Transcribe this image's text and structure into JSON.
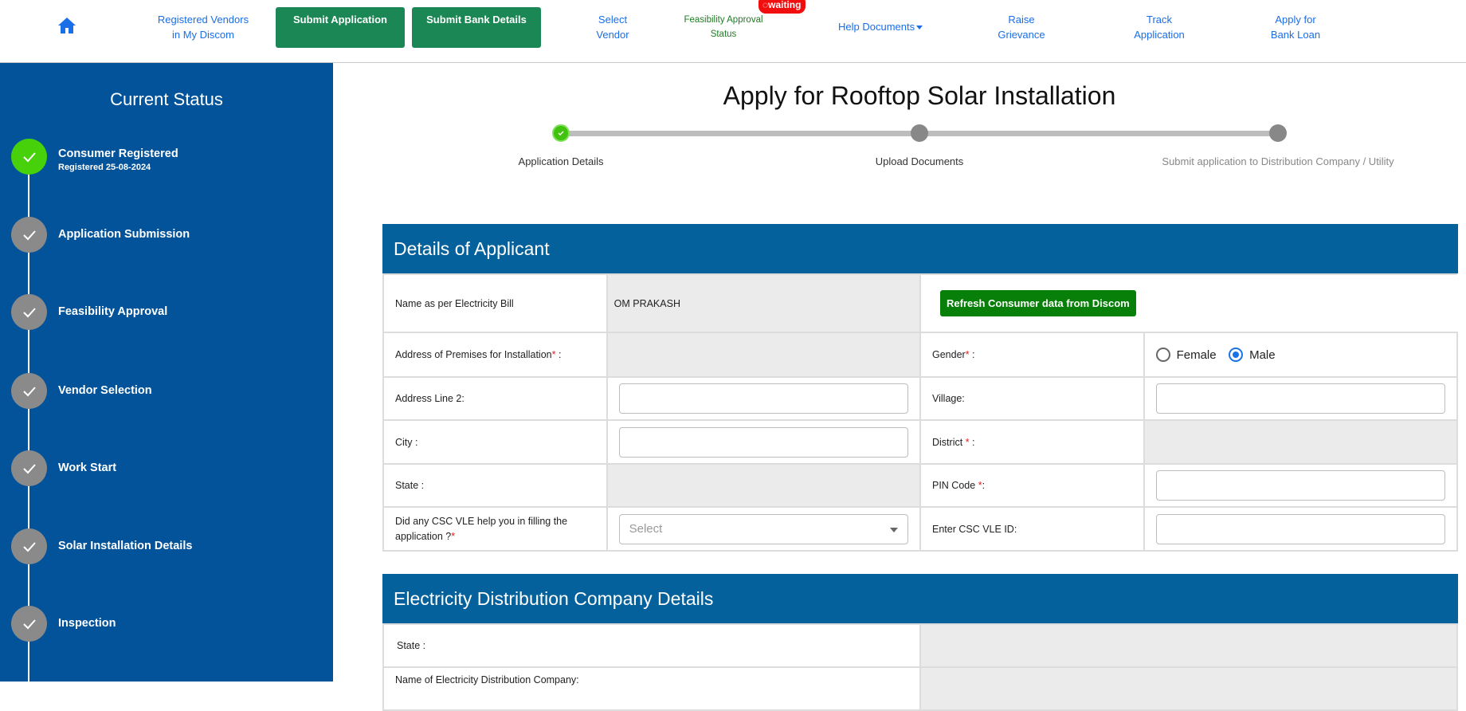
{
  "nav": {
    "home_icon": "home-icon",
    "registered_vendors": "Registered Vendors in My Discom",
    "submit_application": "Submit Application",
    "submit_bank_details": "Submit Bank Details",
    "select_vendor": "Select Vendor",
    "feasibility": "Feasibility Approval Status",
    "feasibility_badge": "◌waiting",
    "help_documents": "Help Documents",
    "raise_grievance": "Raise Grievance",
    "track_application": "Track Application",
    "apply_bank_loan": "Apply for Bank Loan"
  },
  "sidebar": {
    "title": "Current Status",
    "steps": [
      {
        "label": "Consumer Registered",
        "sub": "Registered 25-08-2024",
        "done": true
      },
      {
        "label": "Application Submission"
      },
      {
        "label": "Feasibility Approval"
      },
      {
        "label": "Vendor Selection"
      },
      {
        "label": "Work Start"
      },
      {
        "label": "Solar Installation Details"
      },
      {
        "label": "Inspection"
      }
    ]
  },
  "main": {
    "title": "Apply for Rooftop Solar Installation",
    "progress": [
      {
        "label": "Application Details",
        "status": "done"
      },
      {
        "label": "Upload Documents",
        "status": "pending"
      },
      {
        "label": "Submit application to Distribution Company / Utility",
        "status": "pending"
      }
    ],
    "applicant": {
      "heading": "Details of Applicant",
      "name_label": "Name as per Electricity Bill",
      "name_value": "OM PRAKASH",
      "refresh_button": "Refresh Consumer data from Discom",
      "address_label": "Address of Premises for Installation",
      "gender_label": "Gender",
      "gender_options": [
        "Female",
        "Male"
      ],
      "gender_selected": "Male",
      "address2_label": "Address Line 2:",
      "village_label": "Village:",
      "city_label": "City :",
      "district_label": "District",
      "state_label": "State :",
      "pin_label": "PIN Code",
      "csc_label": "Did any CSC VLE help you in filling the application ?",
      "csc_select_placeholder": "Select",
      "csc_id_label": "Enter CSC VLE ID:"
    },
    "discom": {
      "heading": "Electricity Distribution Company Details",
      "state_label": "State :",
      "company_label": "Name of Electricity Distribution Company:"
    }
  }
}
